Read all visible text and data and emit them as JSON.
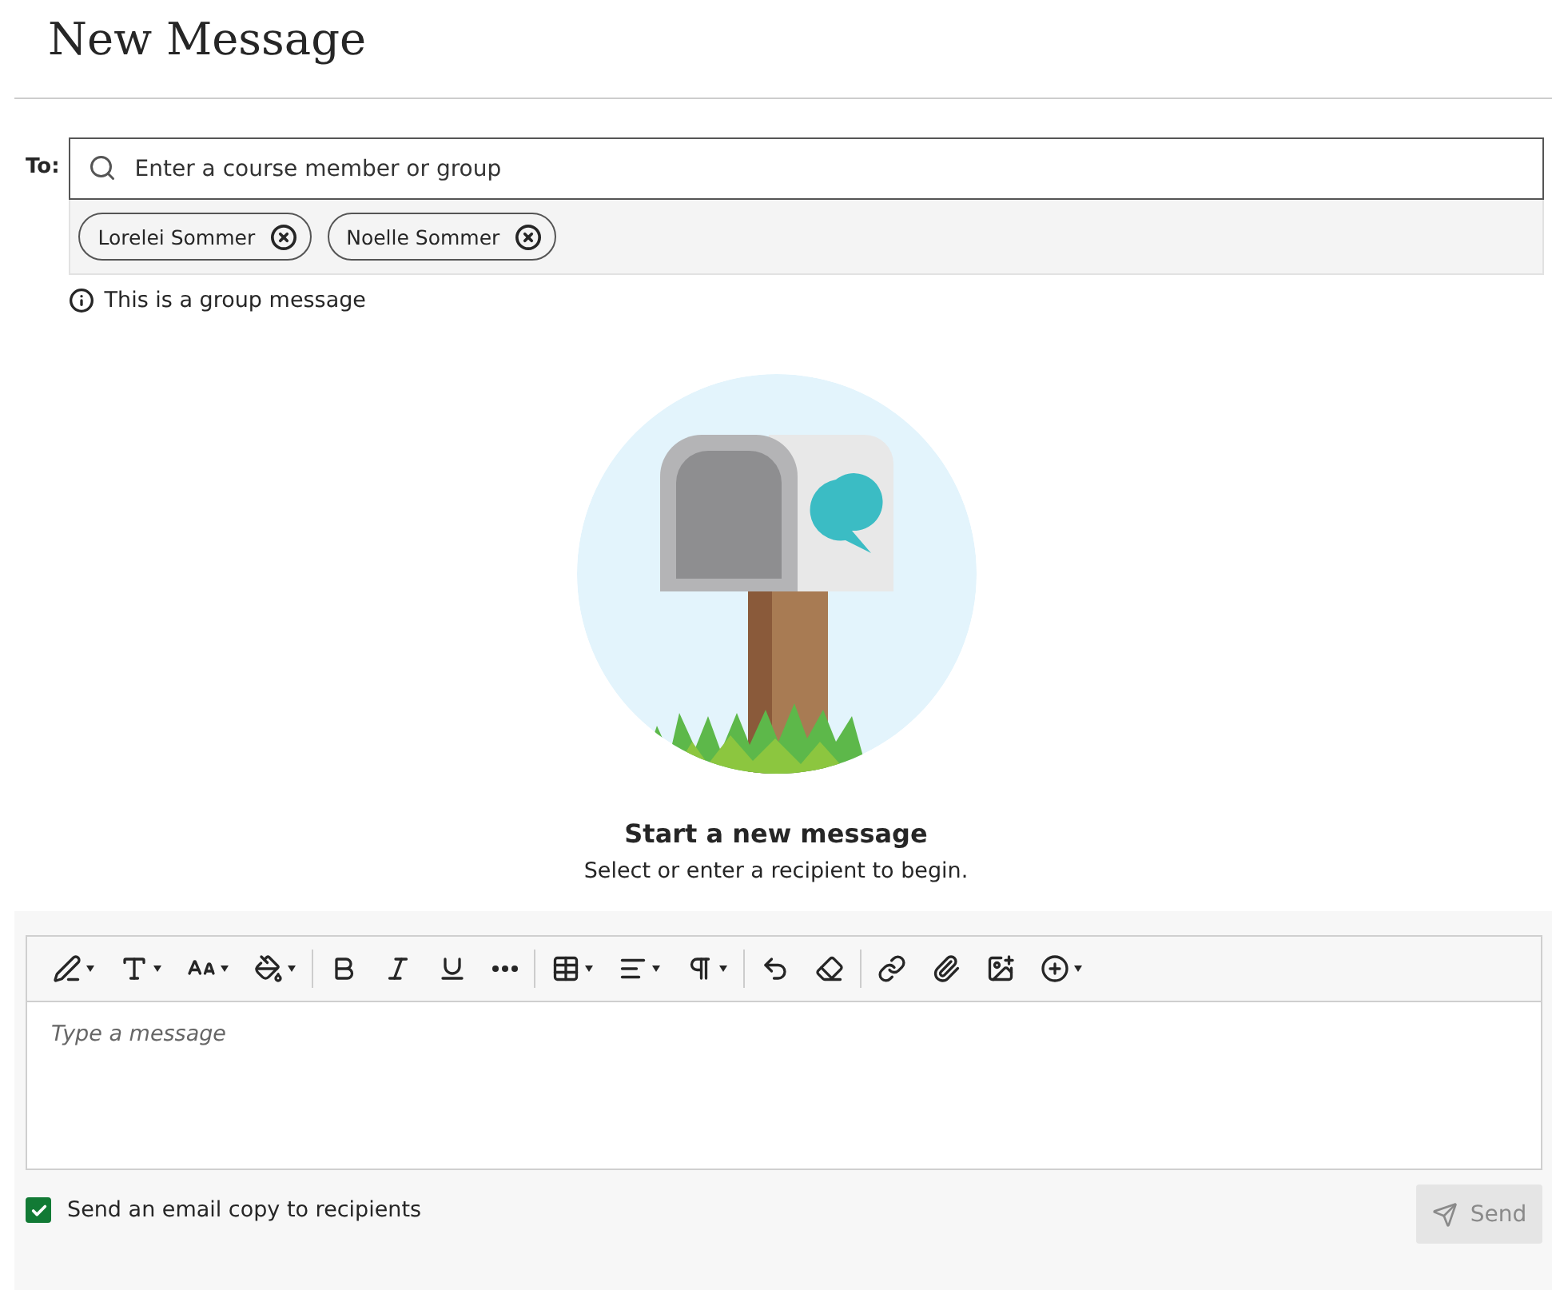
{
  "title": "New Message",
  "recipients": {
    "label": "To:",
    "placeholder": "Enter a course member or group",
    "chips": [
      {
        "name": "Lorelei Sommer"
      },
      {
        "name": "Noelle Sommer"
      }
    ],
    "note": "This is a group message"
  },
  "empty_state": {
    "heading": "Start a new message",
    "text": "Select or enter a recipient to begin."
  },
  "editor": {
    "placeholder": "Type a message"
  },
  "email_copy": {
    "label": "Send an email copy to recipients",
    "checked": true
  },
  "send_button": {
    "label": "Send",
    "disabled": true
  }
}
